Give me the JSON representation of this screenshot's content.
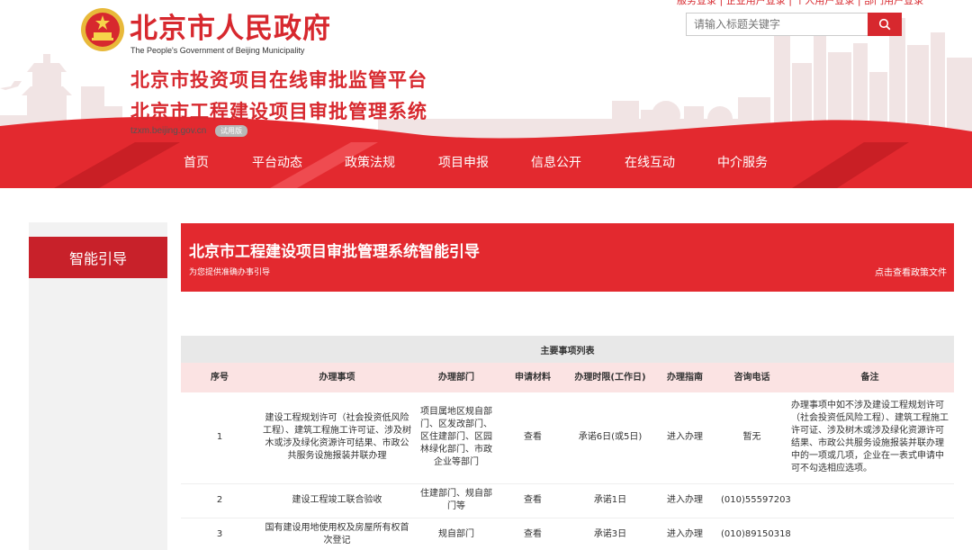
{
  "header": {
    "gov_title": "北京市人民政府",
    "gov_subtitle": "The People's Government of Beijing Municipality",
    "system_title_1": "北京市投资项目在线审批监管平台",
    "system_title_2": "北京市工程建设项目审批管理系统",
    "domain": "tzxm.beijing.gov.cn",
    "beta_badge": "试用版",
    "top_links": "服务登录 | 企业用户登录 | 个人用户登录 | 部门用户登录",
    "search_placeholder": "请输入标题关键字",
    "search_icon": "search-icon",
    "brand_color": "#d7282e"
  },
  "nav": {
    "items": [
      "首页",
      "平台动态",
      "政策法规",
      "项目申报",
      "信息公开",
      "在线互动",
      "中介服务"
    ]
  },
  "sidebar": {
    "active_label": "智能引导"
  },
  "banner": {
    "title": "北京市工程建设项目审批管理系统智能引导",
    "subtitle": "为您提供准确办事引导",
    "policy_link": "点击查看政策文件"
  },
  "table": {
    "caption": "主要事项列表",
    "headers": [
      "序号",
      "办理事项",
      "办理部门",
      "申请材料",
      "办理时限(工作日)",
      "办理指南",
      "咨询电话",
      "备注"
    ],
    "rows": [
      {
        "no": "1",
        "item": "建设工程规划许可（社会投资低风险工程）、建筑工程施工许可证、涉及树木或涉及绿化资源许可结果、市政公共服务设施报装并联办理",
        "dept": "项目属地区规自部门、区发改部门、区住建部门、区园林绿化部门、市政企业等部门",
        "materials": "查看",
        "time_limit": "承诺6日(或5日)",
        "guide": "进入办理",
        "phone": "暂无",
        "note": "办理事项中如不涉及建设工程规划许可（社会投资低风险工程）、建筑工程施工许可证、涉及树木或涉及绿化资源许可结果、市政公共服务设施报装并联办理中的一项或几项，企业在一表式申请中可不勾选相应选项。"
      },
      {
        "no": "2",
        "item": "建设工程竣工联合验收",
        "dept": "住建部门、规自部门等",
        "materials": "查看",
        "time_limit": "承诺1日",
        "guide": "进入办理",
        "phone": "(010)55597203",
        "note": ""
      },
      {
        "no": "3",
        "item": "国有建设用地使用权及房屋所有权首次登记",
        "dept": "规自部门",
        "materials": "查看",
        "time_limit": "承诺3日",
        "guide": "进入办理",
        "phone": "(010)89150318",
        "note": ""
      }
    ]
  }
}
